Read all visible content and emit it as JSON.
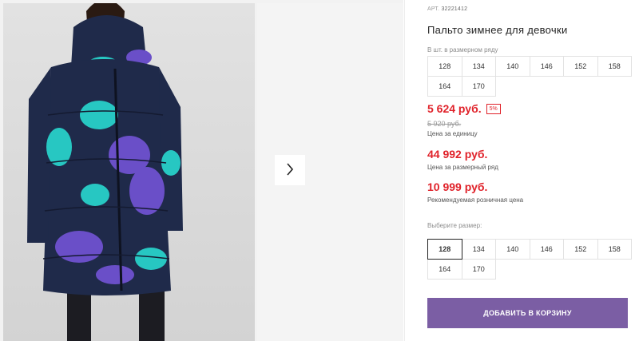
{
  "product": {
    "article_label": "АРТ.",
    "article_value": "32221412",
    "title": "Пальто зимнее для девочки"
  },
  "size_row": {
    "label": "В шт. в размерном ряду",
    "sizes": [
      "128",
      "134",
      "140",
      "146",
      "152",
      "158",
      "164",
      "170"
    ]
  },
  "pricing": {
    "price": "5 624 руб.",
    "discount": "5%",
    "old_price": "5 920 руб.",
    "price_caption": "Цена за единицу",
    "row_price": "44 992 руб.",
    "row_price_caption": "Цена за размерный ряд",
    "rrp": "10 999 руб.",
    "rrp_caption": "Рекомендуемая розничная цена"
  },
  "size_select": {
    "label": "Выберите размер:",
    "sizes": [
      "128",
      "134",
      "140",
      "146",
      "152",
      "158",
      "164",
      "170"
    ],
    "selected": "128"
  },
  "actions": {
    "add_to_cart": "ДОБАВИТЬ В КОРЗИНУ"
  },
  "icons": {
    "gallery_next": "chevron-right-icon"
  },
  "colors": {
    "accent": "#7b5ea4",
    "price": "#e0222a"
  }
}
